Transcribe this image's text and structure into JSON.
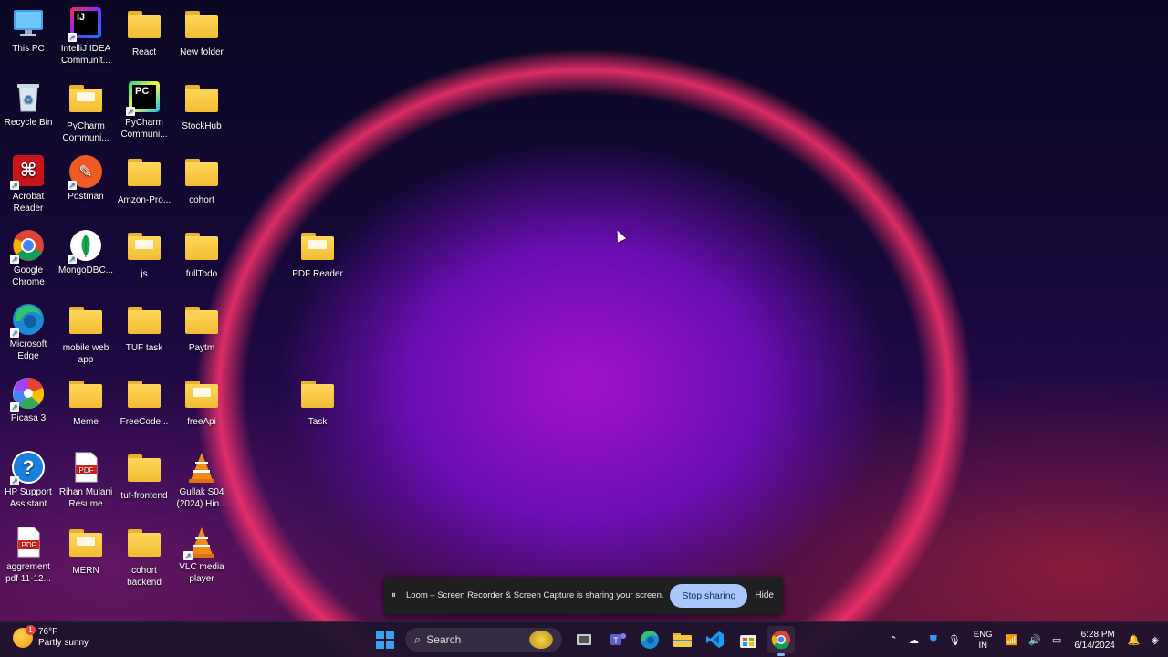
{
  "desktop_icons": [
    {
      "label": "This PC",
      "icon": "monitor-icon"
    },
    {
      "label": "IntelliJ IDEA Communit...",
      "icon": "intellij-icon"
    },
    {
      "label": "React",
      "icon": "folder-icon"
    },
    {
      "label": "New folder",
      "icon": "folder-icon"
    },
    {
      "label": "Recycle Bin",
      "icon": "recycle-bin-icon"
    },
    {
      "label": "PyCharm Communi...",
      "icon": "folder-icon"
    },
    {
      "label": "PyCharm Communi...",
      "icon": "pycharm-icon"
    },
    {
      "label": "StockHub",
      "icon": "folder-icon"
    },
    {
      "label": "Acrobat Reader",
      "icon": "acrobat-icon"
    },
    {
      "label": "Postman",
      "icon": "postman-icon"
    },
    {
      "label": "Amzon-Pro...",
      "icon": "folder-icon"
    },
    {
      "label": "cohort",
      "icon": "folder-icon"
    },
    {
      "label": "Google Chrome",
      "icon": "chrome-icon"
    },
    {
      "label": "MongoDBC...",
      "icon": "mongodb-icon"
    },
    {
      "label": "js",
      "icon": "folder-icon"
    },
    {
      "label": "fullTodo",
      "icon": "folder-icon"
    },
    {
      "label": "PDF Reader",
      "icon": "folder-icon"
    },
    {
      "label": "Microsoft Edge",
      "icon": "edge-icon"
    },
    {
      "label": "mobile web app",
      "icon": "folder-icon"
    },
    {
      "label": "TUF task",
      "icon": "folder-icon"
    },
    {
      "label": "Paytm",
      "icon": "folder-icon"
    },
    {
      "label": "Picasa 3",
      "icon": "picasa-icon"
    },
    {
      "label": "Meme",
      "icon": "folder-icon"
    },
    {
      "label": "FreeCode...",
      "icon": "folder-icon"
    },
    {
      "label": "freeApi",
      "icon": "folder-icon"
    },
    {
      "label": "Task",
      "icon": "folder-icon"
    },
    {
      "label": "HP Support Assistant",
      "icon": "hp-support-icon"
    },
    {
      "label": "Rihan Mulani Resume",
      "icon": "pdf-icon"
    },
    {
      "label": "tuf-frontend",
      "icon": "folder-icon"
    },
    {
      "label": "Gullak S04 (2024) Hin...",
      "icon": "vlc-icon"
    },
    {
      "label": "aggrement pdf 11-12...",
      "icon": "pdf-icon"
    },
    {
      "label": "MERN",
      "icon": "folder-icon"
    },
    {
      "label": "cohort backend",
      "icon": "folder-icon"
    },
    {
      "label": "VLC media player",
      "icon": "vlc-icon"
    }
  ],
  "loom": {
    "message": "Loom – Screen Recorder & Screen Capture is sharing your screen.",
    "stop_label": "Stop sharing",
    "hide_label": "Hide"
  },
  "taskbar": {
    "weather_temp": "76°F",
    "weather_desc": "Partly sunny",
    "weather_badge": "1",
    "search_placeholder": "Search",
    "lang_top": "ENG",
    "lang_bottom": "IN",
    "time": "6:28 PM",
    "date": "6/14/2024"
  },
  "colors": {
    "accent": "#a9c7fa",
    "folder": "#f2bc34"
  }
}
